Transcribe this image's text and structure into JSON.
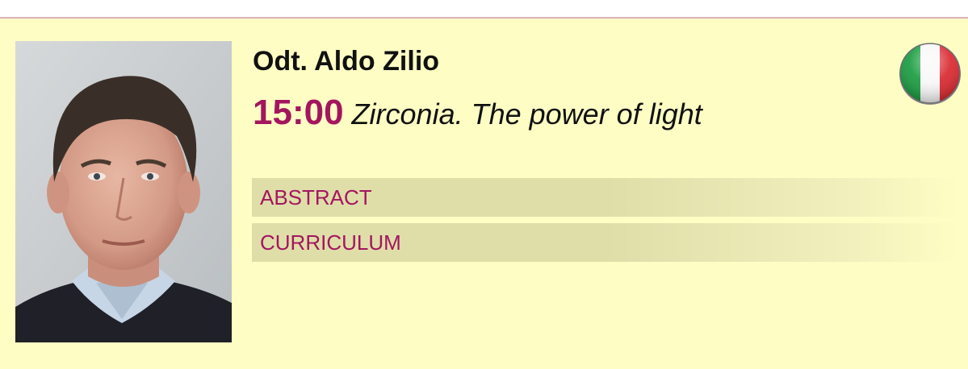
{
  "speaker": {
    "name": "Odt. Aldo Zilio",
    "country_flag_icon": "italy-flag-icon"
  },
  "talk": {
    "time": "15:00",
    "title": "Zirconia. The power of light"
  },
  "links": {
    "abstract_label": "ABSTRACT",
    "curriculum_label": "CURRICULUM"
  },
  "colors": {
    "card_background": "#fefec4",
    "accent": "#a3165f",
    "link_bar": "#dfdea9",
    "top_border": "#d9b3b8"
  }
}
